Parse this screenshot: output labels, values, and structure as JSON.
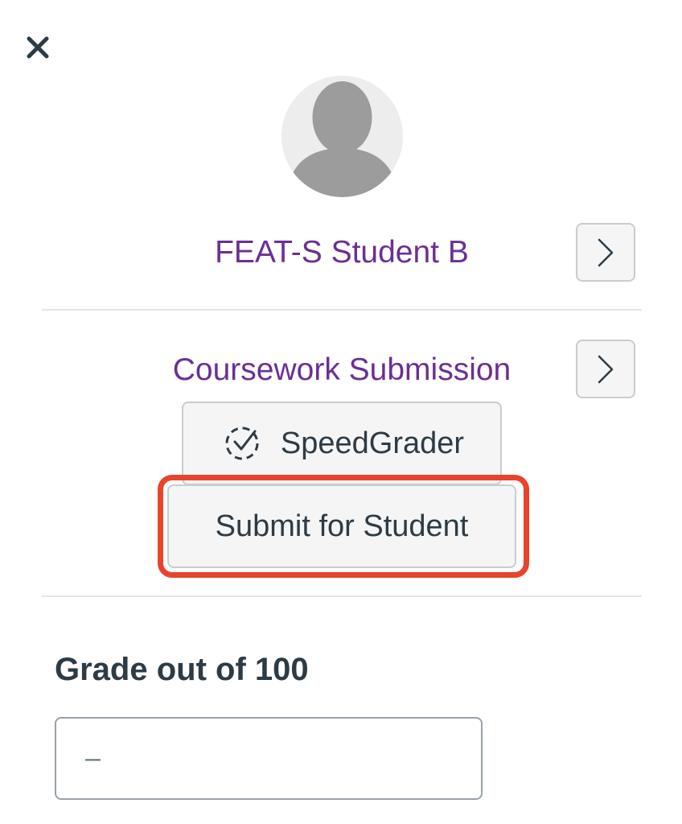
{
  "header": {
    "close_icon": "close-icon"
  },
  "student": {
    "avatar_icon": "user-silhouette-icon",
    "name": "FEAT-S Student B",
    "next_icon": "chevron-right-icon"
  },
  "assignment": {
    "name": "Coursework Submission",
    "next_icon": "chevron-right-icon"
  },
  "actions": {
    "speedgrader_label": "SpeedGrader",
    "speedgrader_icon": "speedgrader-check-icon",
    "submit_for_student_label": "Submit for Student"
  },
  "grade": {
    "label": "Grade out of 100",
    "placeholder": "–",
    "value": ""
  },
  "colors": {
    "link": "#6b2f94",
    "text": "#2d3b45",
    "highlight": "#e8442c"
  }
}
